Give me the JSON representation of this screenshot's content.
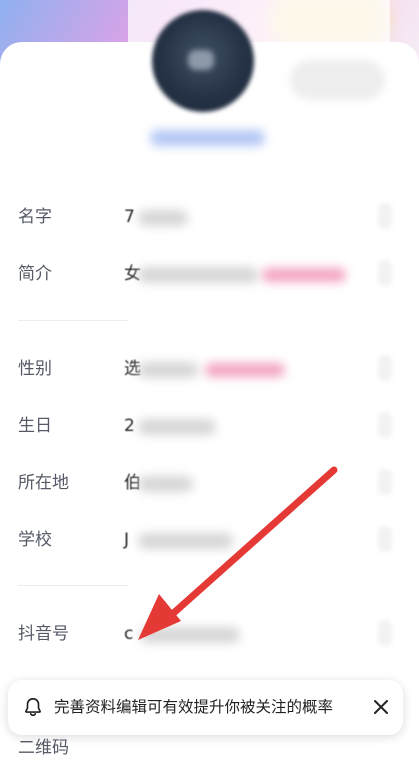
{
  "profile_edit": {
    "fields": {
      "name_label": "名字",
      "intro_label": "简介",
      "gender_label": "性别",
      "birthday_label": "生日",
      "location_label": "所在地",
      "school_label": "学校",
      "douyin_id_label": "抖音号",
      "qrcode_label": "二维码"
    },
    "peek_chars": {
      "name": "7",
      "intro": "女",
      "gender": "选",
      "birthday": "2",
      "location": "伯",
      "school": "J",
      "douyin_id": "c"
    }
  },
  "toast": {
    "message": "完善资料编辑可有效提升你被关注的概率"
  },
  "colors": {
    "annotation_arrow": "#e53935",
    "label_text": "#555a66",
    "toast_text": "#222222"
  },
  "icons": {
    "bell": "bell-icon",
    "close": "close-icon"
  }
}
